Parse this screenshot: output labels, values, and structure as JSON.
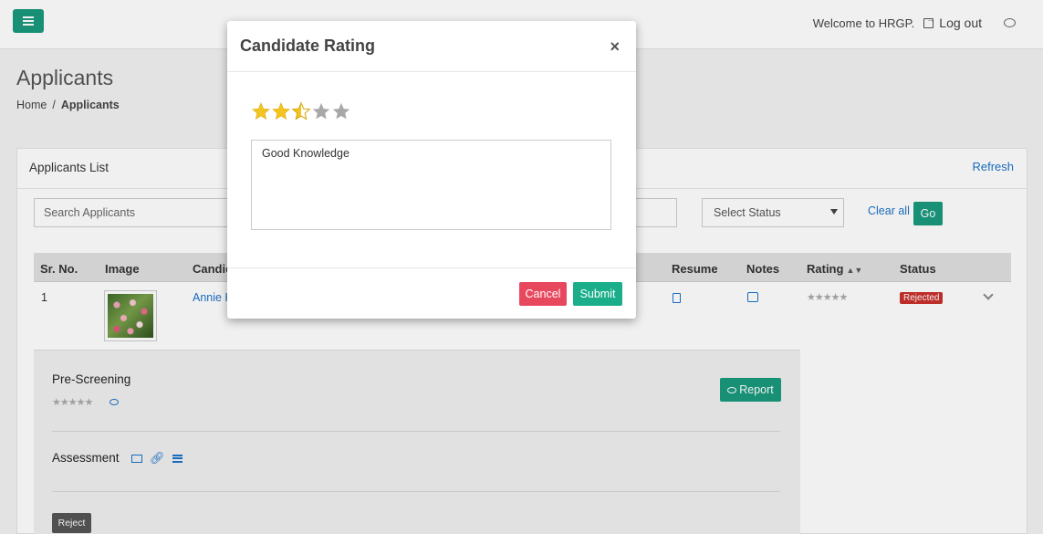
{
  "topbar": {
    "welcome_text": "Welcome to HRGP.",
    "logout_label": "Log out"
  },
  "page": {
    "title": "Applicants",
    "breadcrumb": {
      "home": "Home",
      "separator": "/",
      "current": "Applicants"
    }
  },
  "card": {
    "title": "Applicants List",
    "refresh_label": "Refresh"
  },
  "filters": {
    "search_placeholder": "Search Applicants",
    "status_selected": "Select Status",
    "clear_label": "Clear all",
    "go_label": "Go"
  },
  "table": {
    "headers": {
      "sr_no": "Sr. No.",
      "image": "Image",
      "candidate": "Candic",
      "resume": "Resume",
      "notes": "Notes",
      "rating": "Rating",
      "status": "Status"
    },
    "rows": [
      {
        "sr_no": "1",
        "candidate": "Annie H",
        "rating_stars": "★★★★★",
        "status": "Rejected"
      }
    ]
  },
  "details": {
    "prescreening_title": "Pre-Screening",
    "prescreening_stars": "★★★★★",
    "report_label": "Report",
    "assessment_title": "Assessment",
    "reject_label": "Reject"
  },
  "modal": {
    "title": "Candidate Rating",
    "close_symbol": "×",
    "rating_value": 2.5,
    "rating_max": 5,
    "comment": "Good Knowledge",
    "cancel_label": "Cancel",
    "submit_label": "Submit"
  },
  "colors": {
    "primary_green": "#1a9a7e",
    "submit_green": "#1aae8a",
    "cancel_red": "#e8485e",
    "rejected_red": "#c9302c",
    "link_blue": "#1a73c9",
    "star_gold": "#f4c51e",
    "star_gray": "#a8a8a8"
  },
  "icons": {
    "menu": "hamburger-icon",
    "logout": "logout-icon",
    "chat": "chat-icon",
    "resume": "document-icon",
    "notes": "note-icon",
    "sort": "sort-icon",
    "expand": "chevron-down-icon",
    "view": "eye-icon",
    "email": "envelope-icon",
    "link": "link-icon",
    "list": "list-icon",
    "close": "close-icon"
  }
}
